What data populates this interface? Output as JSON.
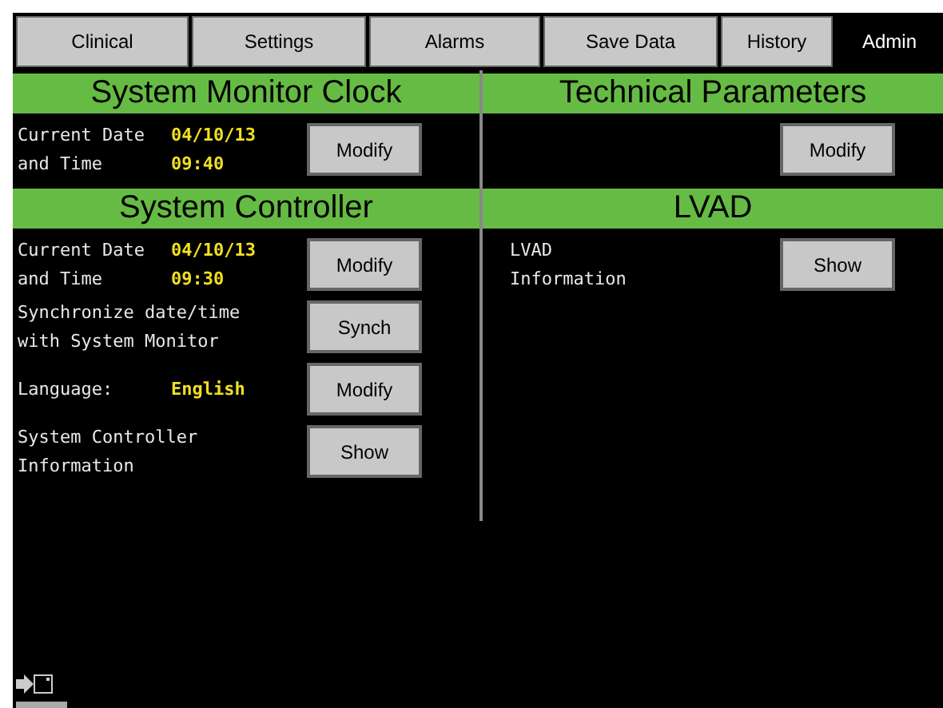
{
  "tabs": [
    {
      "label": "Clinical",
      "selected": false
    },
    {
      "label": "Settings",
      "selected": false
    },
    {
      "label": "Alarms",
      "selected": false
    },
    {
      "label": "Save Data",
      "selected": false
    },
    {
      "label": "History",
      "selected": false
    },
    {
      "label": "Admin",
      "selected": true
    }
  ],
  "columns": [
    [
      {
        "title": "System Monitor Clock",
        "rows": [
          {
            "lines": [
              {
                "label": "Current Date",
                "value": "04/10/13"
              },
              {
                "label": "and Time",
                "value": "09:40"
              }
            ],
            "button": "Modify"
          }
        ]
      },
      {
        "title": "System Controller",
        "rows": [
          {
            "lines": [
              {
                "label": "Current Date",
                "value": "04/10/13"
              },
              {
                "label": "and Time",
                "value": "09:30"
              }
            ],
            "button": "Modify"
          },
          {
            "lines": [
              {
                "label": "Synchronize date/time"
              },
              {
                "label": "with System Monitor"
              }
            ],
            "button": "Synch"
          },
          {
            "lines": [
              {
                "label": "Language:",
                "value": "English"
              }
            ],
            "button": "Modify"
          },
          {
            "lines": [
              {
                "label": "System Controller"
              },
              {
                "label": "Information"
              }
            ],
            "button": "Show"
          }
        ]
      }
    ],
    [
      {
        "title": "Technical Parameters",
        "rows": [
          {
            "lines": [],
            "button": "Modify"
          }
        ]
      },
      {
        "title": "LVAD",
        "rows": [
          {
            "lines": [
              {
                "label": "LVAD"
              },
              {
                "label": "Information"
              }
            ],
            "button": "Show"
          }
        ]
      }
    ]
  ]
}
